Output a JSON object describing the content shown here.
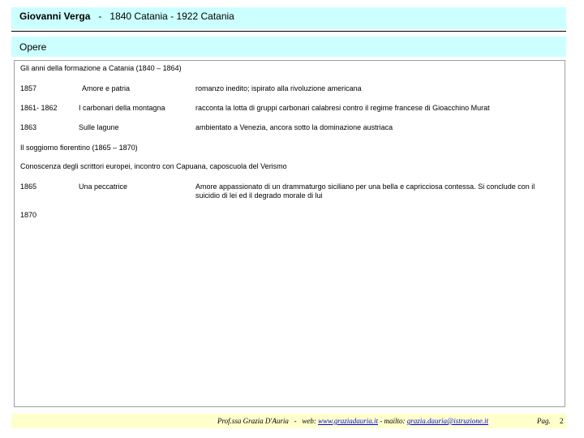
{
  "header": {
    "author": "Giovanni Verga",
    "separator": "-",
    "dates": "1840 Catania - 1922 Catania"
  },
  "section": {
    "title": "Opere"
  },
  "content": {
    "period1_heading": "Gli anni della formazione a Catania (1840 – 1864)",
    "rows1": [
      {
        "year": "1857",
        "title": "Amore e patria",
        "description": "romanzo inedito; ispirato alla rivoluzione americana"
      },
      {
        "year": "1861- 1862",
        "title": "I carbonari della montagna",
        "description": "racconta la lotta di gruppi carbonari calabresi contro il regime francese di Gioacchino Murat"
      },
      {
        "year": "1863",
        "title": "Sulle lagune",
        "description": "ambientato a Venezia, ancora sotto la dominazione austriaca"
      }
    ],
    "period2_heading": "Il soggiorno fiorentino (1865 – 1870)",
    "period2_note": "Conoscenza degli scrittori europei, incontro con Capuana, caposcuola del Verismo",
    "rows2": [
      {
        "year": "1865",
        "title": "Una peccatrice",
        "description": "Amore appassionato di un drammaturgo siciliano per una bella e capricciosa contessa. Si conclude con il suicidio di lei ed il degrado morale di lui"
      }
    ],
    "year_1870": "1870"
  },
  "footer": {
    "author": "Prof.ssa Grazia D'Auria",
    "sep": "-",
    "web_label": "web:",
    "web_url": "www.graziadauria.it",
    "mail_label": "- mailto:",
    "mail": "grazia.dauria@istruzione.it",
    "page_label": "Pag.",
    "page_number": "2"
  }
}
